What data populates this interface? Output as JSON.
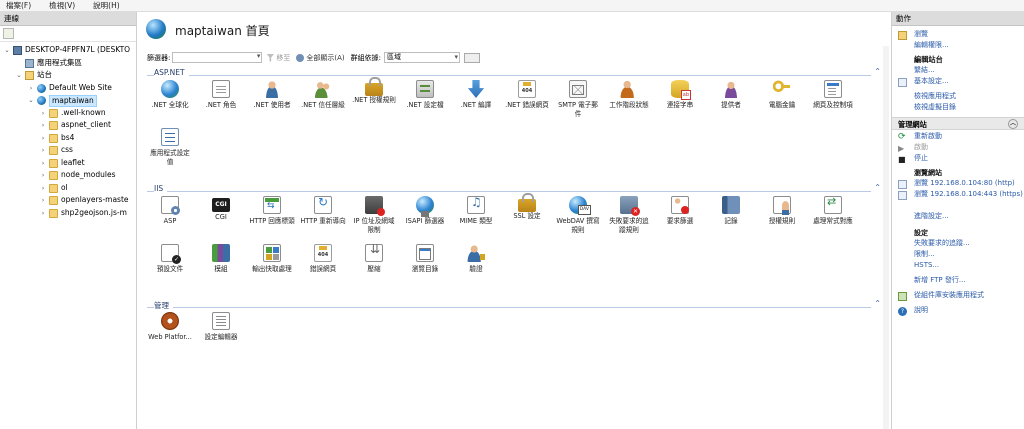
{
  "menubar": {
    "items": [
      "檔案(F)",
      "檢視(V)",
      "說明(H)"
    ]
  },
  "connections": {
    "header": "連線",
    "tree": [
      {
        "label": "DESKTOP-4FPFN7L (DESKTO",
        "icon": "computer-icon",
        "level": 0,
        "expanded": true
      },
      {
        "label": "應用程式集區",
        "icon": "app-pool-icon",
        "level": 1,
        "expanded": null
      },
      {
        "label": "站台",
        "icon": "sites-icon",
        "level": 1,
        "expanded": true
      },
      {
        "label": "Default Web Site",
        "icon": "globe-icon",
        "level": 2,
        "expanded": false
      },
      {
        "label": "maptaiwan",
        "icon": "globe-icon",
        "level": 2,
        "expanded": true,
        "selected": true
      },
      {
        "label": ".well-known",
        "icon": "folder-icon",
        "level": 3,
        "expanded": false
      },
      {
        "label": "aspnet_client",
        "icon": "folder-icon",
        "level": 3,
        "expanded": false
      },
      {
        "label": "bs4",
        "icon": "folder-icon",
        "level": 3,
        "expanded": false
      },
      {
        "label": "css",
        "icon": "folder-icon",
        "level": 3,
        "expanded": false
      },
      {
        "label": "leaflet",
        "icon": "folder-icon",
        "level": 3,
        "expanded": false
      },
      {
        "label": "node_modules",
        "icon": "folder-icon",
        "level": 3,
        "expanded": false
      },
      {
        "label": "ol",
        "icon": "folder-icon",
        "level": 3,
        "expanded": false
      },
      {
        "label": "openlayers-maste",
        "icon": "folder-icon",
        "level": 3,
        "expanded": false
      },
      {
        "label": "shp2geojson.js-m",
        "icon": "folder-icon",
        "level": 3,
        "expanded": false
      }
    ]
  },
  "main": {
    "title": "maptaiwan 首頁",
    "filter": {
      "label": "篩選器:",
      "go_label": "移至",
      "show_all_label": "全部顯示(A)",
      "group_by_label": "群組依據:",
      "group_by_value": "區域"
    },
    "sections": [
      {
        "title": "ASP.NET",
        "features": [
          {
            "label": ".NET 全球化",
            "icon": "i-globe",
            "name": "net-globalization-icon"
          },
          {
            "label": ".NET 角色",
            "icon": "i-doc",
            "name": "net-roles-icon"
          },
          {
            "label": ".NET 使用者",
            "icon": "i-user",
            "name": "net-users-icon"
          },
          {
            "label": ".NET 信任層級",
            "icon": "i-users",
            "name": "net-trust-levels-icon"
          },
          {
            "label": ".NET 授權規則",
            "icon": "i-lock",
            "name": "net-authorization-rules-icon"
          },
          {
            "label": ".NET 設定檔",
            "icon": "i-server",
            "name": "net-profile-icon"
          },
          {
            "label": ".NET 編譯",
            "icon": "i-arrow-down",
            "name": "net-compilation-icon"
          },
          {
            "label": ".NET 錯誤網頁",
            "icon": "i-404",
            "name": "net-error-pages-icon"
          },
          {
            "label": "SMTP 電子郵件",
            "icon": "i-mail",
            "name": "smtp-email-icon"
          },
          {
            "label": "工作階段狀態",
            "icon": "i-person-tool",
            "name": "session-state-icon"
          },
          {
            "label": "連接字串",
            "icon": "i-db",
            "name": "connection-strings-icon"
          },
          {
            "label": "提供者",
            "icon": "i-provider",
            "name": "providers-icon"
          },
          {
            "label": "電腦金鑰",
            "icon": "i-key",
            "name": "machine-key-icon"
          },
          {
            "label": "網頁及控制項",
            "icon": "i-pages",
            "name": "pages-controls-icon"
          },
          {
            "label": "應用程式設定值",
            "icon": "i-list",
            "name": "app-settings-icon"
          }
        ]
      },
      {
        "title": "IIS",
        "features": [
          {
            "label": "ASP",
            "icon": "i-asp",
            "name": "asp-icon"
          },
          {
            "label": "CGI",
            "icon": "i-cgi",
            "name": "cgi-icon",
            "text": "CGI"
          },
          {
            "label": "HTTP 回應標頭",
            "icon": "i-hdr",
            "name": "http-response-headers-icon"
          },
          {
            "label": "HTTP 重新導向",
            "icon": "i-redir",
            "name": "http-redirect-icon"
          },
          {
            "label": "IP 位址及網域限制",
            "icon": "i-ipblock",
            "name": "ip-restrictions-icon"
          },
          {
            "label": "ISAPI 篩選器",
            "icon": "i-isapi",
            "name": "isapi-filters-icon"
          },
          {
            "label": "MIME 類型",
            "icon": "i-mime",
            "name": "mime-types-icon"
          },
          {
            "label": "SSL 設定",
            "icon": "i-ssl",
            "name": "ssl-settings-icon"
          },
          {
            "label": "WebDAV 撰寫規則",
            "icon": "i-dav",
            "name": "webdav-authoring-icon"
          },
          {
            "label": "失敗要求的追蹤規則",
            "icon": "i-failed",
            "name": "failed-request-tracing-icon"
          },
          {
            "label": "要求篩選",
            "icon": "i-reqfilter",
            "name": "request-filtering-icon"
          },
          {
            "label": "記錄",
            "icon": "i-log",
            "name": "logging-icon"
          },
          {
            "label": "授權規則",
            "icon": "i-authz",
            "name": "authorization-rules-icon"
          },
          {
            "label": "處理常式對應",
            "icon": "i-handler",
            "name": "handler-mappings-icon"
          },
          {
            "label": "預設文件",
            "icon": "i-defdoc",
            "name": "default-document-icon"
          },
          {
            "label": "模組",
            "icon": "i-modules",
            "name": "modules-icon"
          },
          {
            "label": "輸出快取處理",
            "icon": "i-outcache",
            "name": "output-caching-icon"
          },
          {
            "label": "錯誤網頁",
            "icon": "i-404",
            "name": "error-pages-icon"
          },
          {
            "label": "壓縮",
            "icon": "i-compress",
            "name": "compression-icon"
          },
          {
            "label": "瀏覽目錄",
            "icon": "i-browse",
            "name": "directory-browsing-icon"
          },
          {
            "label": "驗證",
            "icon": "i-auth",
            "name": "authentication-icon"
          }
        ]
      },
      {
        "title": "管理",
        "features": [
          {
            "label": "Web Platfor...",
            "icon": "i-webpi",
            "name": "web-platform-installer-icon"
          },
          {
            "label": "設定編輯器",
            "icon": "i-config",
            "name": "configuration-editor-icon"
          }
        ]
      }
    ]
  },
  "actions": {
    "header": "動作",
    "explore": "瀏覽",
    "edit_permissions": "編輯權限...",
    "edit_site_head": "編輯站台",
    "bindings": "繫結...",
    "basic_settings": "基本設定...",
    "view_applications": "檢視應用程式",
    "view_virtual_dirs": "檢視虛擬目錄",
    "manage_site_head": "管理網站",
    "restart": "重新啟動",
    "start": "啟動",
    "stop": "停止",
    "browse_site_head": "瀏覽網站",
    "browse_80": "瀏覽 192.168.0.104:80 (http)",
    "browse_443": "瀏覽 192.168.0.104:443 (https)",
    "advanced_settings": "進階設定...",
    "config_head": "設定",
    "failed_tracing": "失敗要求的追蹤...",
    "limits": "限制...",
    "hsts": "HSTS...",
    "add_ftp": "新增 FTP 發行...",
    "install_from_gallery": "從組件庫安裝應用程式",
    "help": "說明"
  }
}
